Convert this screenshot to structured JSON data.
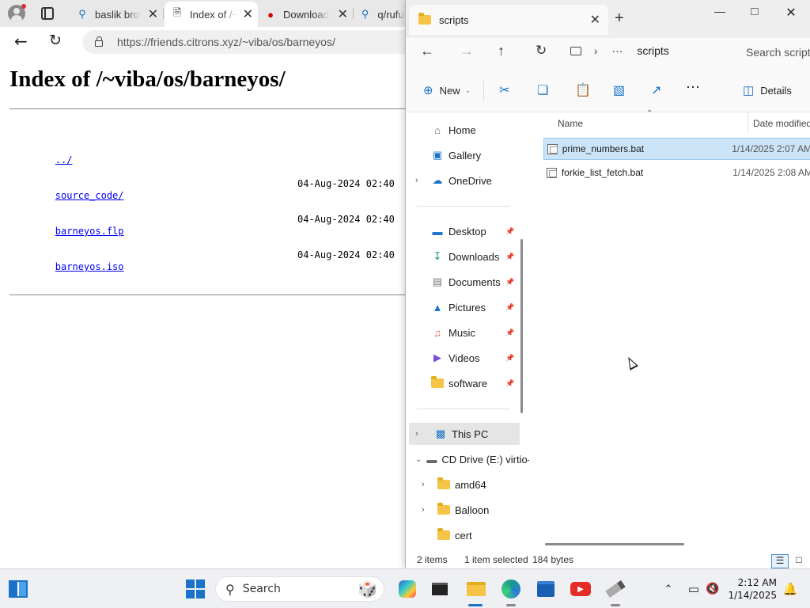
{
  "browser": {
    "tabs": [
      {
        "label": "baslik brows",
        "icon": "search-icon"
      },
      {
        "label": "Index of /~viba/os/barneyos/",
        "icon": "document-icon"
      },
      {
        "label": "Download",
        "icon": "record-icon"
      },
      {
        "label": "q/rufus",
        "icon": "search-icon"
      }
    ],
    "address": "https://friends.citrons.xyz/~viba/os/barneyos/",
    "page": {
      "heading": "Index of /~viba/os/barneyos/",
      "entries": [
        {
          "name": "../",
          "date": ""
        },
        {
          "name": "source_code/",
          "date": "04-Aug-2024 02:40"
        },
        {
          "name": "barneyos.flp",
          "date": "04-Aug-2024 02:40"
        },
        {
          "name": "barneyos.iso",
          "date": "04-Aug-2024 02:40"
        }
      ]
    }
  },
  "explorer": {
    "tab_title": "scripts",
    "breadcrumb": {
      "more": "···",
      "current": "scripts"
    },
    "search_placeholder": "Search scripts",
    "commands": {
      "new": "New",
      "details": "Details"
    },
    "nav": {
      "home": "Home",
      "gallery": "Gallery",
      "onedrive": "OneDrive",
      "desktop": "Desktop",
      "downloads": "Downloads",
      "documents": "Documents",
      "pictures": "Pictures",
      "music": "Music",
      "videos": "Videos",
      "software": "software",
      "this_pc": "This PC",
      "cd_drive": "CD Drive (E:) virtio-win",
      "amd64": "amd64",
      "balloon": "Balloon",
      "cert": "cert"
    },
    "columns": {
      "name": "Name",
      "date": "Date modified"
    },
    "files": [
      {
        "name": "prime_numbers.bat",
        "date": "1/14/2025 2:07 AM",
        "selected": true
      },
      {
        "name": "forkie_list_fetch.bat",
        "date": "1/14/2025 2:08 AM",
        "selected": false
      }
    ],
    "status": {
      "count": "2 items",
      "selected": "1 item selected",
      "size": "184 bytes"
    }
  },
  "taskbar": {
    "search": "Search",
    "time": "2:12 AM",
    "date": "1/14/2025"
  },
  "colors": {
    "accent": "#1a73c8",
    "selection": "#cce4f7",
    "folder": "#f5c446"
  }
}
